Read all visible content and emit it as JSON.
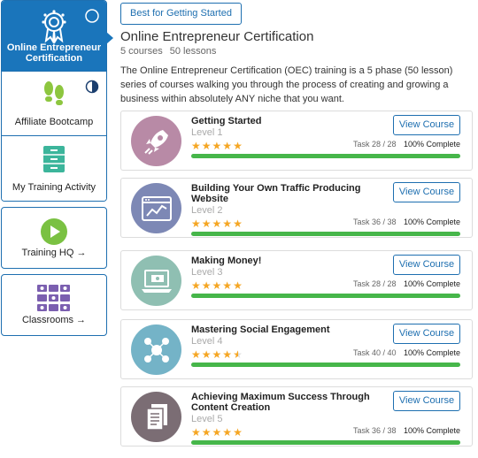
{
  "sidebar": {
    "items": [
      {
        "label": "Online Entrepreneur Certification",
        "icon": "award-ribbon-icon",
        "active": true
      },
      {
        "label": "Affiliate Bootcamp",
        "icon": "footprints-icon"
      },
      {
        "label": "My Training Activity",
        "icon": "filing-cabinet-icon"
      }
    ],
    "cards": [
      {
        "label": "Training HQ →",
        "icon": "play-circle-icon"
      },
      {
        "label": "Classrooms →",
        "icon": "classroom-grid-icon"
      }
    ]
  },
  "header": {
    "tag": "Best for Getting Started",
    "title": "Online Entrepreneur Certification",
    "courses_count": "5 courses",
    "lessons_count": "50 lessons",
    "description": "The Online Entrepreneur Certification (OEC) training is a 5 phase (50 lesson) series of courses walking you through the process of creating and growing a business within absolutely ANY niche that you want."
  },
  "courses": [
    {
      "title": "Getting Started",
      "level": "Level 1",
      "rating": 5,
      "task": "Task 28 / 28",
      "progress_label": "100% Complete",
      "progress": 1.0,
      "button": "View Course",
      "icon": "rocket-icon",
      "color": "#b88aa6"
    },
    {
      "title": "Building Your Own Traffic Producing Website",
      "level": "Level 2",
      "rating": 5,
      "task": "Task 36 / 38",
      "progress_label": "100% Complete",
      "progress": 1.0,
      "button": "View Course",
      "icon": "website-chart-icon",
      "color": "#7d88b5"
    },
    {
      "title": "Making Money!",
      "level": "Level 3",
      "rating": 5,
      "task": "Task 28 / 28",
      "progress_label": "100% Complete",
      "progress": 1.0,
      "button": "View Course",
      "icon": "laptop-money-icon",
      "color": "#8fbfb2"
    },
    {
      "title": "Mastering Social Engagement",
      "level": "Level 4",
      "rating": 4.5,
      "task": "Task 40 / 40",
      "progress_label": "100% Complete",
      "progress": 1.0,
      "button": "View Course",
      "icon": "social-network-icon",
      "color": "#74b3c7"
    },
    {
      "title": "Achieving Maximum Success Through Content Creation",
      "level": "Level 5",
      "rating": 5,
      "task": "Task 36 / 38",
      "progress_label": "100% Complete",
      "progress": 1.0,
      "button": "View Course",
      "icon": "documents-icon",
      "color": "#7b6d74"
    }
  ],
  "colors": {
    "accent": "#1a75bb",
    "progress": "#46b64a",
    "stars": "#f5a623"
  }
}
